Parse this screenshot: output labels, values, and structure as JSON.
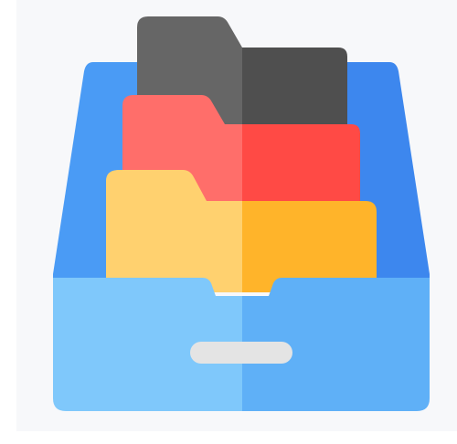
{
  "image": {
    "subject": "file-drawer-icon",
    "description_items": [
      "drawer",
      "dark-folder",
      "red-folder",
      "yellow-folder",
      "drawer-handle"
    ]
  },
  "colors": {
    "panel_background": "#f7f8fa",
    "drawer_back_left": "#4a9bf5",
    "drawer_back_right": "#3d87ee",
    "drawer_front_left": "#7fc8fb",
    "drawer_front_right": "#5fb0f7",
    "dark_folder_left": "#666666",
    "dark_folder_right": "#4f4f4f",
    "red_folder_left": "#ff6e6a",
    "red_folder_right": "#ff4a45",
    "yellow_folder_left": "#ffd16f",
    "yellow_folder_right": "#ffb42a",
    "handle": "#e4e4e4"
  }
}
